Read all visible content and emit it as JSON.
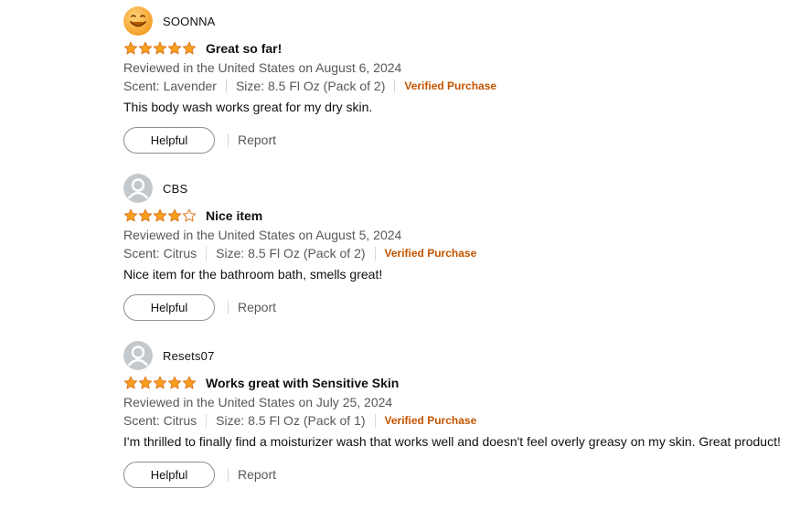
{
  "colors": {
    "star_fill": "#f8a01b",
    "star_outline": "#de7921",
    "verified": "#c45500",
    "secondary_text": "#565959"
  },
  "reviews": [
    {
      "username": "SOONNA",
      "avatar": "smiley-face-icon",
      "rating": 5,
      "title": "Great so far!",
      "date": "Reviewed in the United States on August 6, 2024",
      "scent": "Scent: Lavender",
      "size": "Size: 8.5 Fl Oz (Pack of 2)",
      "verified": "Verified Purchase",
      "body": "This body wash works great for my dry skin.",
      "helpful_label": "Helpful",
      "report_label": "Report"
    },
    {
      "username": "CBS",
      "avatar": "default-user-icon",
      "rating": 4,
      "title": "Nice item",
      "date": "Reviewed in the United States on August 5, 2024",
      "scent": "Scent: Citrus",
      "size": "Size: 8.5 Fl Oz (Pack of 2)",
      "verified": "Verified Purchase",
      "body": "Nice item for the bathroom bath, smells great!",
      "helpful_label": "Helpful",
      "report_label": "Report"
    },
    {
      "username": "Resets07",
      "avatar": "default-user-icon",
      "rating": 5,
      "title": "Works great with Sensitive Skin",
      "date": "Reviewed in the United States on July 25, 2024",
      "scent": "Scent: Citrus",
      "size": "Size: 8.5 Fl Oz (Pack of 1)",
      "verified": "Verified Purchase",
      "body": "I'm thrilled to finally find a moisturizer wash that works well and doesn't feel overly greasy on my skin. Great product!",
      "helpful_label": "Helpful",
      "report_label": "Report"
    }
  ]
}
